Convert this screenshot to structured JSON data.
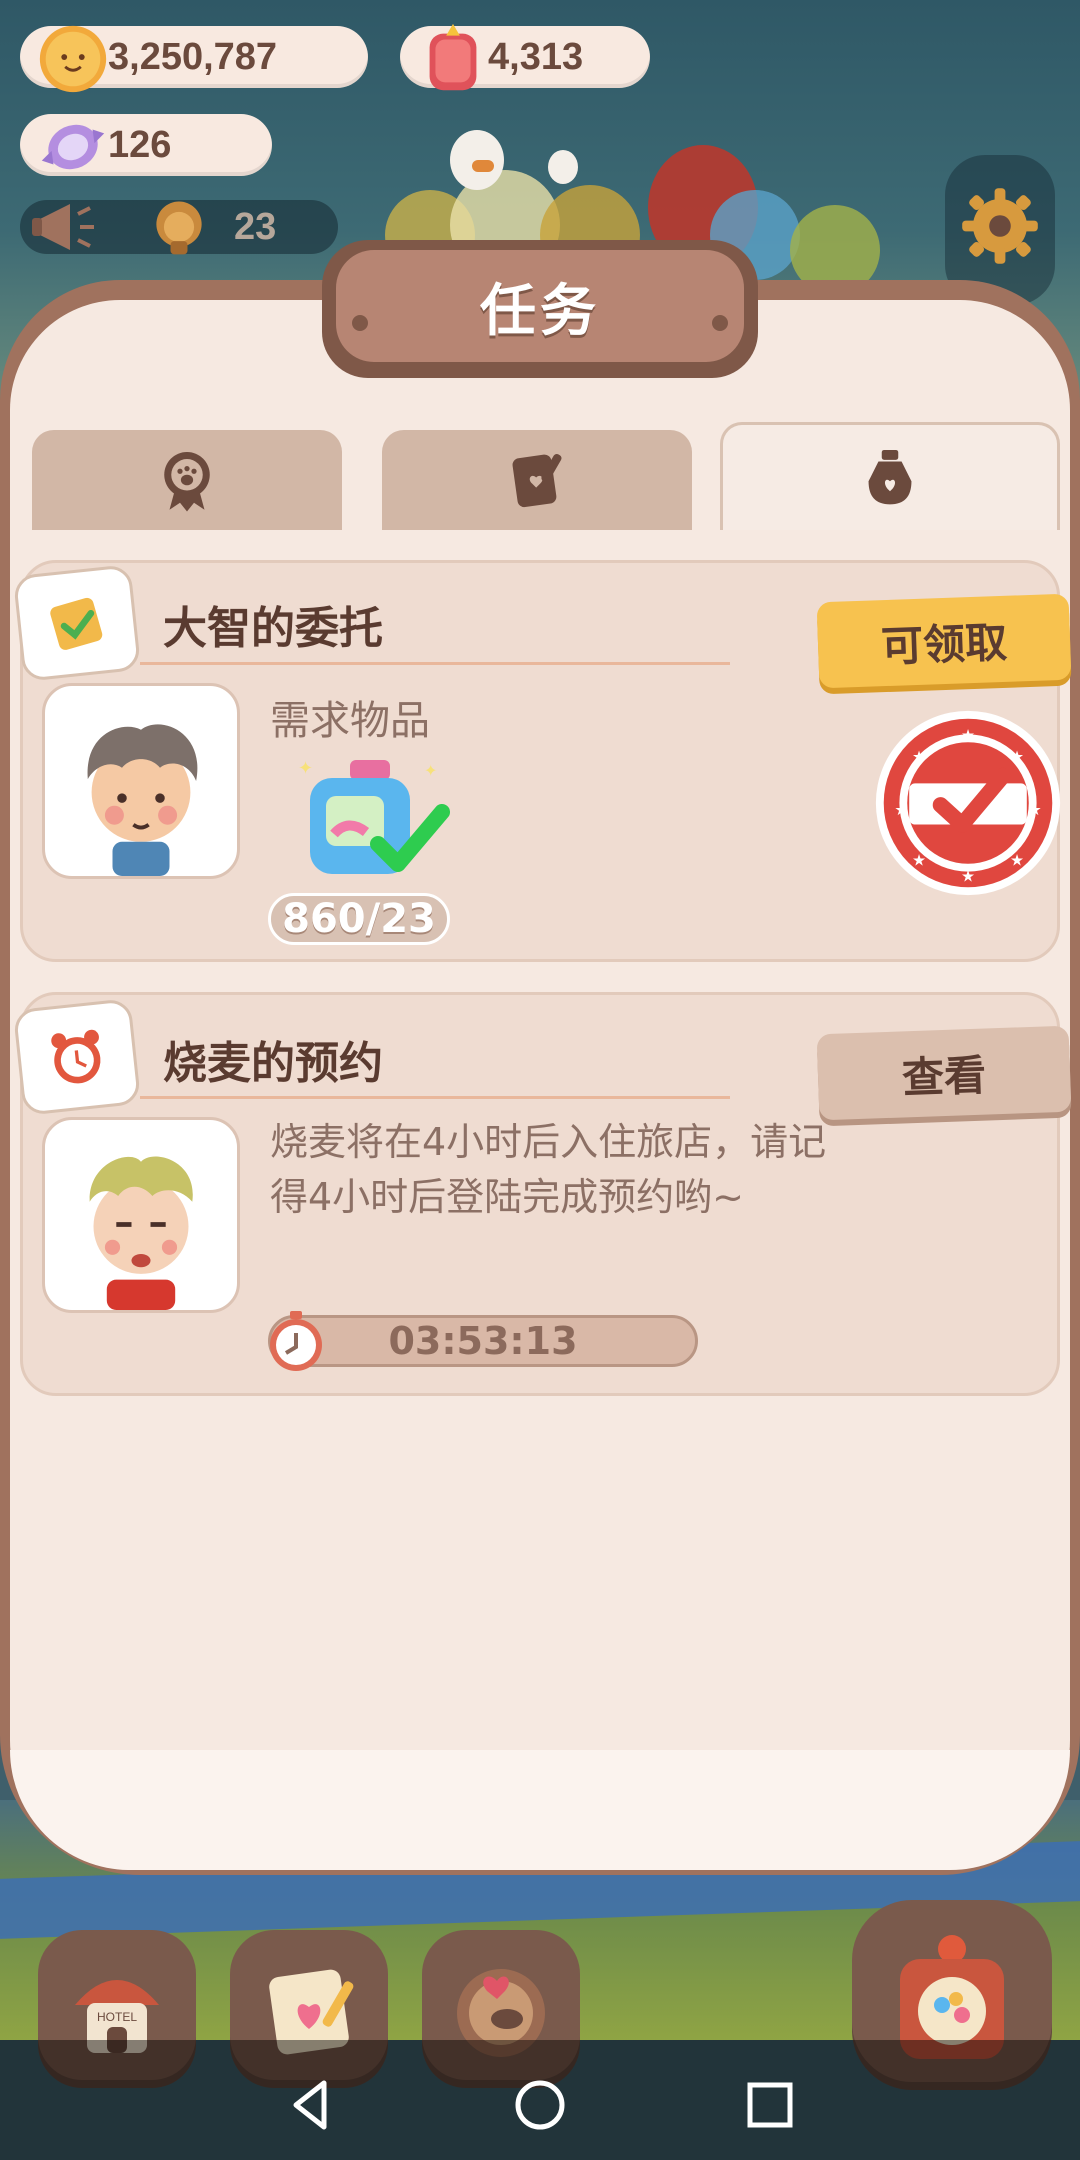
{
  "hud": {
    "coins": "3,250,787",
    "gems": "4,313",
    "candy": "126",
    "event_count": "23"
  },
  "panel": {
    "title": "任务",
    "tabs": [
      {
        "icon": "paw-badge-icon",
        "active": false
      },
      {
        "icon": "clipboard-heart-icon",
        "active": false
      },
      {
        "icon": "bottle-heart-icon",
        "active": true
      }
    ]
  },
  "tasks": [
    {
      "title": "大智的委托",
      "tag_icon": "checklist-note-icon",
      "button_label": "可领取",
      "required_label": "需求物品",
      "required_item_icon": "detergent-bottle-icon",
      "progress": "860/23",
      "completed_stamp": true
    },
    {
      "title": "烧麦的预约",
      "tag_icon": "alarm-clock-icon",
      "button_label": "查看",
      "description": "烧麦将在4小时后入住旅店，请记得4小时后登陆完成预约哟~",
      "timer": "03:53:13"
    }
  ],
  "dock": [
    {
      "icon": "hotel-house-icon"
    },
    {
      "icon": "heart-notebook-icon"
    },
    {
      "icon": "food-plate-icon"
    },
    {
      "icon": "carnival-machine-icon"
    }
  ],
  "colors": {
    "panel_border": "#a0725e",
    "panel_bg": "#f6e9e1",
    "card_bg": "#efdcd1",
    "claim_button": "#f7c24f",
    "stamp_red": "#e0473f",
    "title_text": "#5a3b30"
  }
}
